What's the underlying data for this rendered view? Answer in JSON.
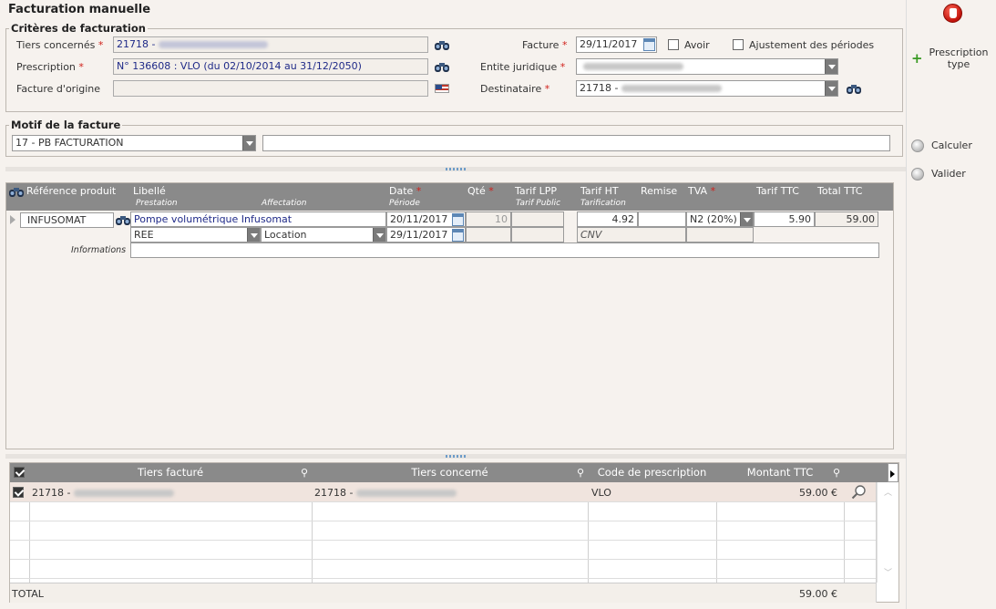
{
  "title": "Facturation manuelle",
  "criteres": {
    "legend": "Critères de facturation",
    "tiers_label": "Tiers concernés",
    "tiers_value": "21718 -",
    "prescription_label": "Prescription",
    "prescription_value": "N° 136608 : VLO (du 02/10/2014 au 31/12/2050)",
    "facture_origine_label": "Facture d'origine",
    "facture_label": "Facture",
    "facture_date": "29/11/2017",
    "avoir_label": "Avoir",
    "ajustement_label": "Ajustement des périodes",
    "entite_label": "Entite juridique",
    "destinataire_label": "Destinataire",
    "destinataire_value": "21718 -",
    "required_mark": "*"
  },
  "motif": {
    "legend": "Motif de la facture",
    "value": "17 - PB FACTURATION"
  },
  "side": {
    "prescription_type": "Prescription type",
    "calculer": "Calculer",
    "valider": "Valider"
  },
  "lines_header": {
    "ref": "Référence produit",
    "libelle": "Libellé",
    "prestation": "Prestation",
    "affectation": "Affectation",
    "date": "Date",
    "periode": "Période",
    "qte": "Qté",
    "tarif_lpp": "Tarif LPP",
    "tarif_public": "Tarif Public",
    "tarif_ht": "Tarif HT",
    "tarification": "Tarification",
    "remise": "Remise",
    "tva": "TVA",
    "tarif_ttc": "Tarif TTC",
    "total_ttc": "Total TTC"
  },
  "line": {
    "ref": "INFUSOMAT",
    "libelle": "Pompe volumétrique Infusomat",
    "date1": "20/11/2017",
    "qte": "10",
    "tarif_ht": "4.92",
    "tva": "N2 (20%)",
    "tarif_ttc": "5.90",
    "total_ttc": "59.00",
    "prestation": "REE",
    "affectation": "Location",
    "date2": "29/11/2017",
    "tarification": "CNV",
    "informations_label": "Informations"
  },
  "grid": {
    "headers": [
      "Tiers facturé",
      "Tiers concerné",
      "Code de prescription",
      "Montant TTC"
    ],
    "row": {
      "tiers_facture": "21718 -",
      "tiers_concerne": "21718 -",
      "code": "VLO",
      "montant": "59.00 €"
    },
    "total_label": "TOTAL",
    "total_value": "59.00 €"
  }
}
